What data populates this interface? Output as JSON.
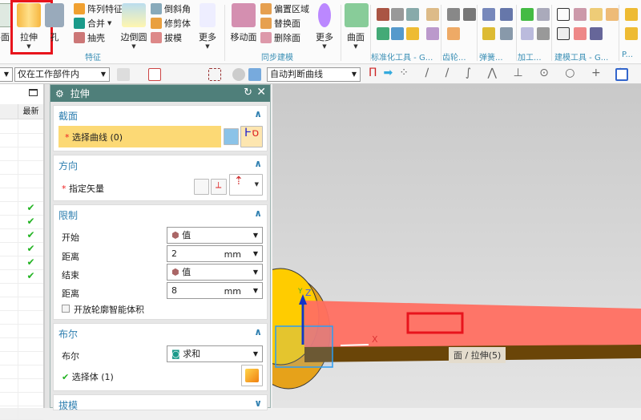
{
  "ribbon": {
    "big": [
      {
        "label": "平面"
      },
      {
        "label": "拉伸"
      },
      {
        "label": "孔"
      },
      {
        "label": "边倒圆"
      },
      {
        "label": "更多"
      },
      {
        "label": "移动面"
      },
      {
        "label": "更多"
      },
      {
        "label": "曲面"
      }
    ],
    "small": [
      "阵列特征",
      "合并",
      "抽壳",
      "倒斜角",
      "修剪体",
      "拔模",
      "偏置区域",
      "替换面",
      "删除面"
    ],
    "groups": [
      "特征",
      "同步建模",
      "标准化工具 - G...",
      "齿轮...",
      "弹簧...",
      "加工...",
      "建模工具 - G...",
      "P..."
    ]
  },
  "toolbar": {
    "filter": "仅在工作部件内",
    "curve_rule": "自动判断曲线"
  },
  "nav": {
    "column": "最新",
    "checks": [
      "✔",
      "✔",
      "✔",
      "✔",
      "✔",
      "✔"
    ]
  },
  "dialog": {
    "title": "拉伸",
    "section": {
      "title": "截面",
      "select_curve": "选择曲线 (0)"
    },
    "direction": {
      "title": "方向",
      "vector": "指定矢量"
    },
    "limits": {
      "title": "限制",
      "start_label": "开始",
      "start_value": "值",
      "dist1_label": "距离",
      "dist1_value": "2",
      "end_label": "结束",
      "end_value": "值",
      "dist2_label": "距离",
      "dist2_value": "8",
      "unit": "mm",
      "open_profile": "开放轮廓智能体积"
    },
    "boolean": {
      "title": "布尔",
      "label": "布尔",
      "value": "求和",
      "select_body": "选择体 (1)"
    },
    "draft": {
      "title": "拔模"
    },
    "required_mark": "*"
  },
  "viewport": {
    "tooltip": "面 / 拉伸(5)",
    "axis_x": "X",
    "axis_z": "Z",
    "axis_y": "Y"
  },
  "colors": {
    "accent": "#4f7f7a",
    "highlight": "#ff6f61",
    "selection": "#fcd975"
  }
}
